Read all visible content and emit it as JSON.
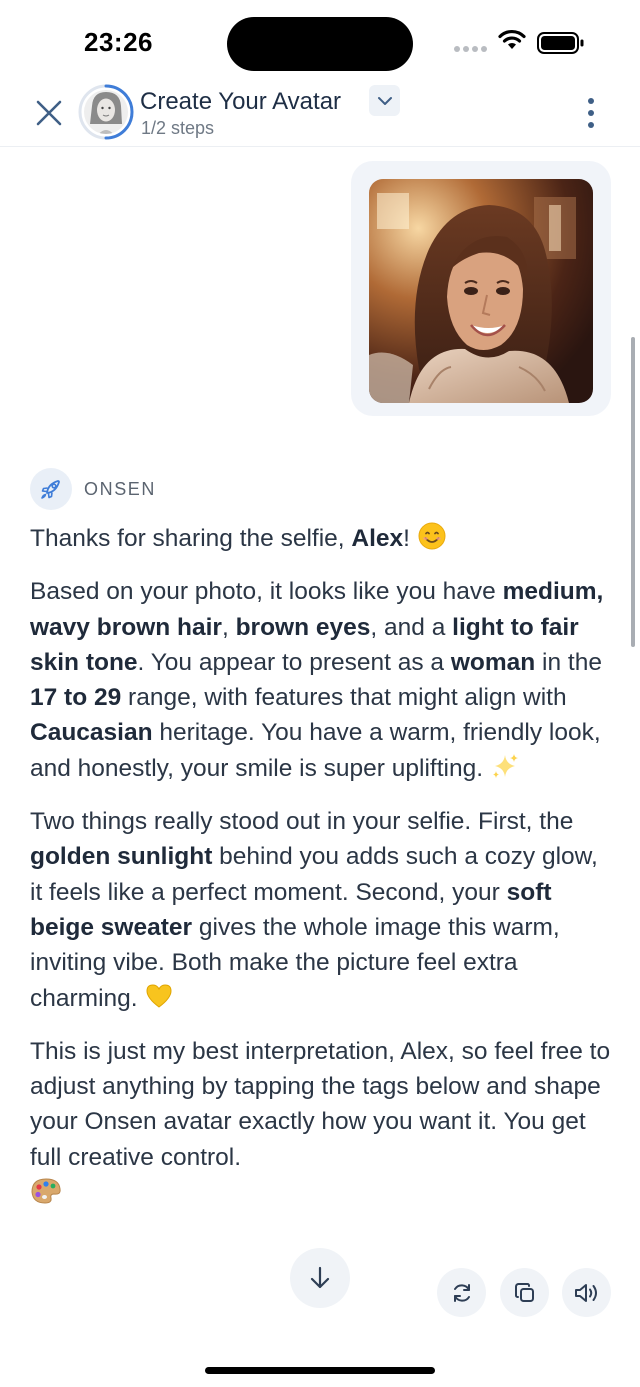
{
  "status_bar": {
    "time": "23:26"
  },
  "header": {
    "title": "Create Your Avatar",
    "subtitle": "1/2 steps",
    "progress": 0.5
  },
  "bot": {
    "name": "ONSEN"
  },
  "message": {
    "p1": {
      "a": "Thanks for sharing the selfie, ",
      "b1": "Alex",
      "c": "! "
    },
    "p2": {
      "t1": "Based on your photo, it looks like you have ",
      "b1": "medium, wavy brown hair",
      "t2": ", ",
      "b2": "brown eyes",
      "t3": ", and a ",
      "b3": "light to fair skin tone",
      "t4": ". You appear to present as a ",
      "b4": "woman",
      "t5": " in the ",
      "b5": "17 to 29",
      "t6": " range, with features that might align with ",
      "b6": "Caucasian",
      "t7": " heritage. You have a warm, friendly look, and honestly, your smile is super uplifting. "
    },
    "p3": {
      "t1": "Two things really stood out in your selfie. First, the ",
      "b1": "golden sunlight",
      "t2": " behind you adds such a cozy glow, it feels like a perfect moment. Second, your ",
      "b2": "soft beige sweater",
      "t3": " gives the whole image this warm, inviting vibe. Both make the picture feel extra charming. "
    },
    "p4": {
      "t1": "This is just my best interpretation, Alex, so feel free to adjust anything by tapping the tags below and shape your Onsen avatar exactly how you want it. You get full creative control."
    }
  },
  "icons": {
    "close": "close-icon",
    "more": "more-vertical-icon",
    "dropdown": "chevron-down-icon",
    "bot": "rocket-icon",
    "scroll": "arrow-down-icon",
    "regenerate": "refresh-icon",
    "copy": "copy-icon",
    "speak": "speaker-icon",
    "emoji_1": "smiling-face-emoji",
    "emoji_2": "sparkles-emoji",
    "emoji_3": "yellow-heart-emoji",
    "emoji_4": "artist-palette-emoji"
  },
  "colors": {
    "accent": "#3f7dd8",
    "text": "#2b3645",
    "bubble": "#f1f4f9",
    "button_bg": "#f0f3f7"
  }
}
